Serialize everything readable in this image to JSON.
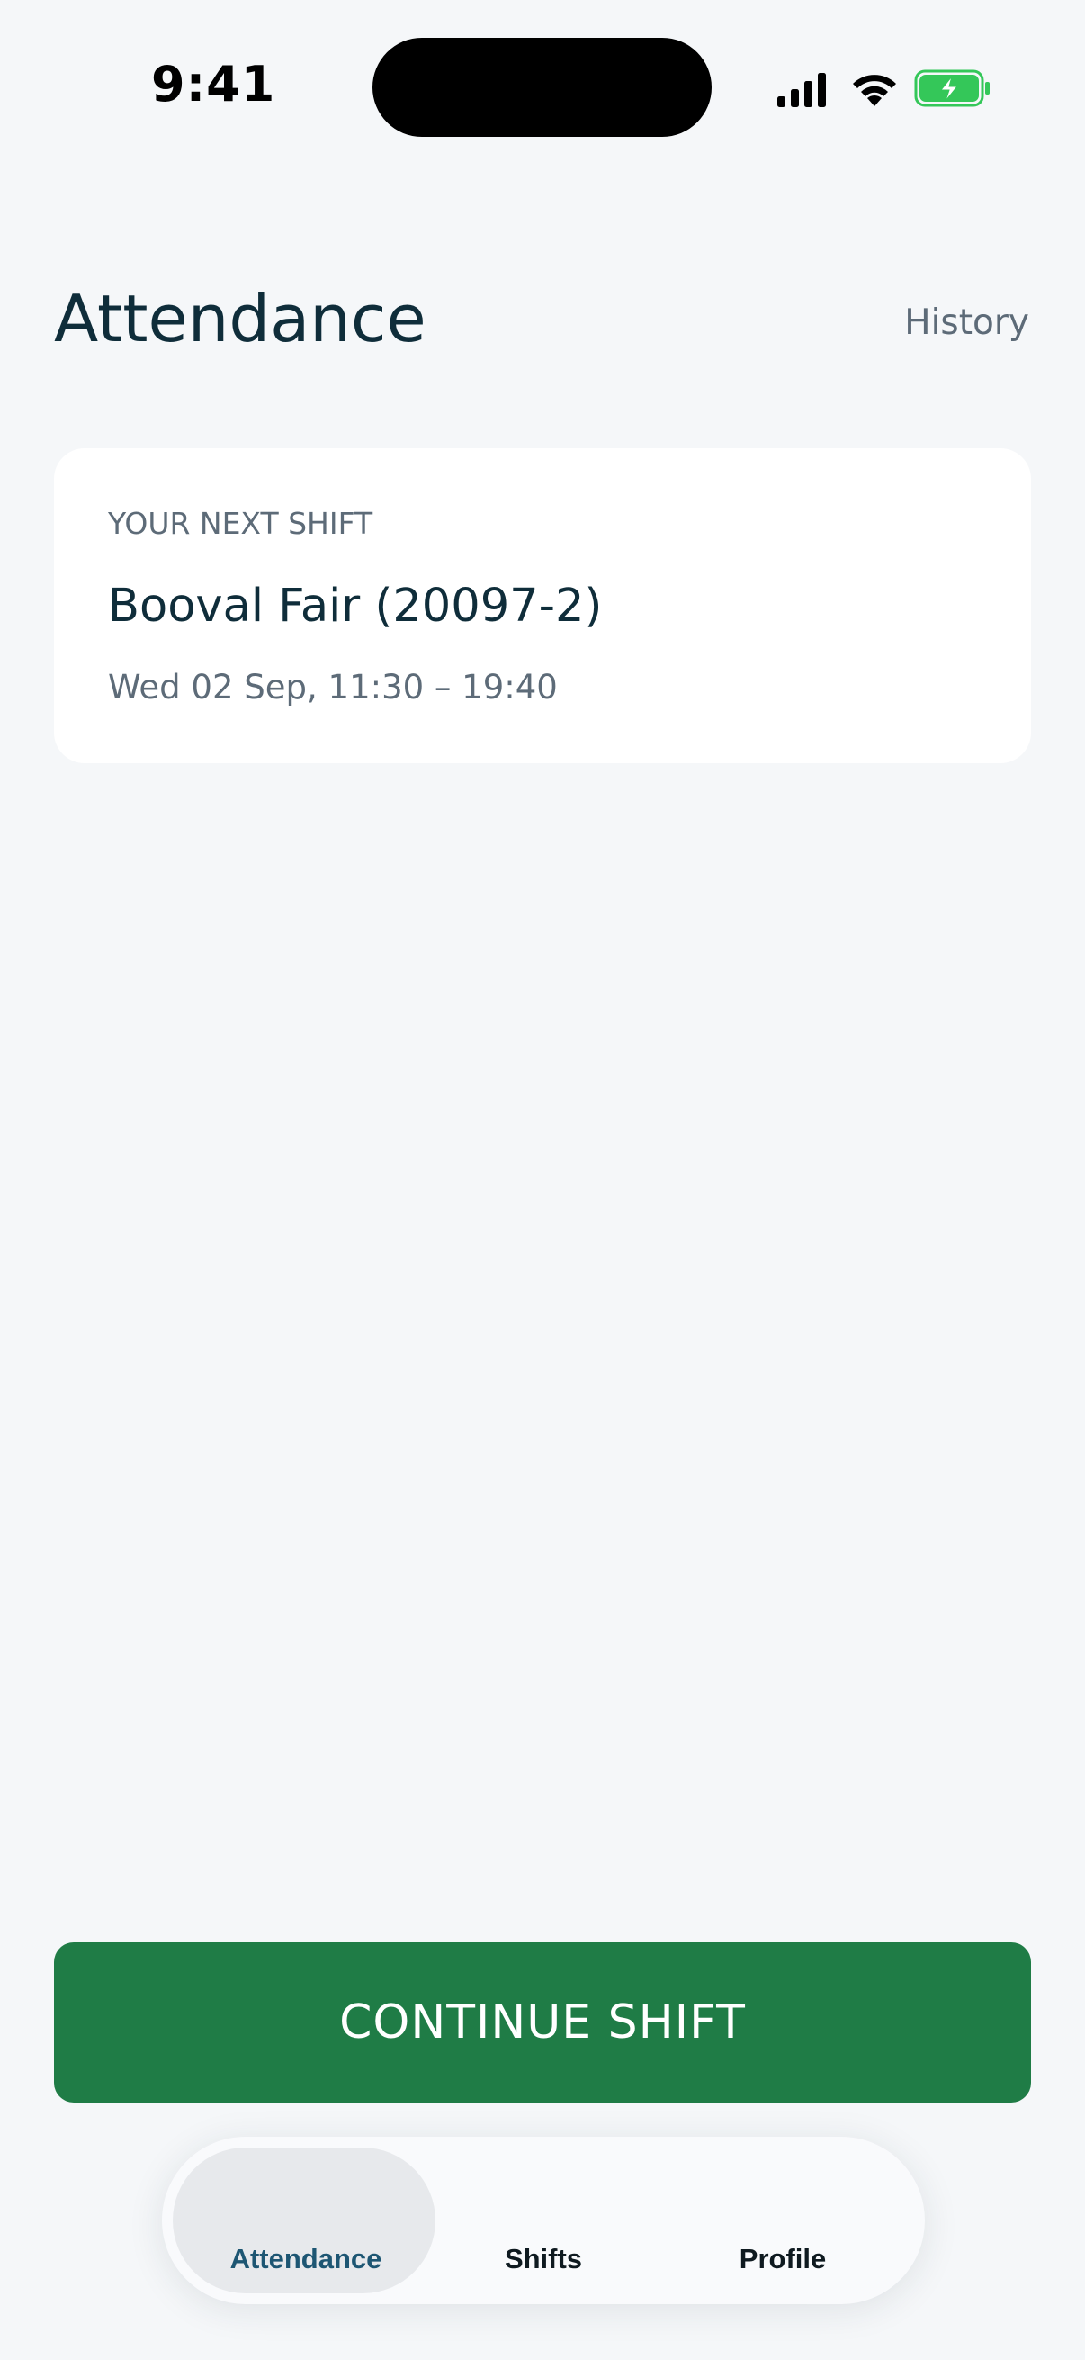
{
  "status_bar": {
    "time": "9:41",
    "icons": [
      "cellular-signal-icon",
      "wifi-icon",
      "battery-charging-icon"
    ],
    "battery_color": "#34c759"
  },
  "header": {
    "title": "Attendance",
    "history_label": "History"
  },
  "next_shift": {
    "eyebrow": "YOUR NEXT SHIFT",
    "location": "Booval Fair (20097-2)",
    "schedule": "Wed 02 Sep, 11:30 – 19:40"
  },
  "actions": {
    "continue_label": "CONTINUE SHIFT"
  },
  "tab_bar": {
    "tabs": [
      {
        "label": "Attendance",
        "active": true
      },
      {
        "label": "Shifts",
        "active": false
      },
      {
        "label": "Profile",
        "active": false
      }
    ]
  },
  "colors": {
    "background": "#f5f7f9",
    "primary_button": "#1f7c46",
    "active_tab_text": "#1d5673",
    "text_primary": "#0f2d3a",
    "text_secondary": "#5d6b78"
  }
}
